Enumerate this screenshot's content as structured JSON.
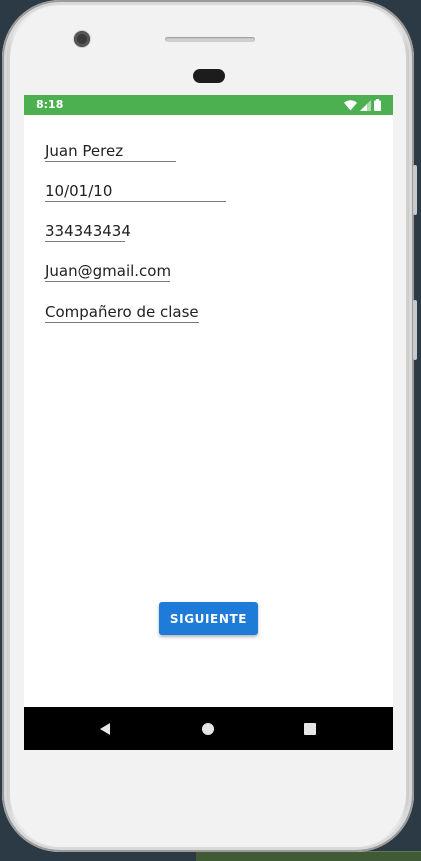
{
  "status_bar": {
    "time": "8:18",
    "color": "#4caf50",
    "icons": [
      "wifi-icon",
      "cell-signal-icon",
      "battery-icon"
    ]
  },
  "form": {
    "fields": [
      {
        "value": "Juan Perez"
      },
      {
        "value": "10/01/10"
      },
      {
        "value": "334343434"
      },
      {
        "value": "Juan@gmail.com"
      },
      {
        "value": "Compañero de clase"
      }
    ]
  },
  "actions": {
    "next_label": "SIGUIENTE",
    "next_color": "#1e7bd8"
  },
  "nav_bar": {
    "buttons": [
      "back-icon",
      "home-icon",
      "recents-icon"
    ]
  }
}
